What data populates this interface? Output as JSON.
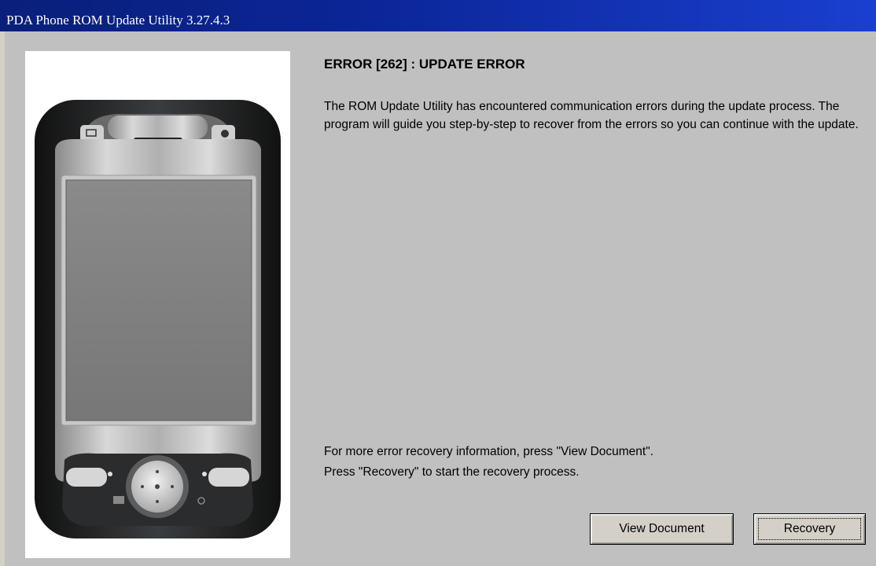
{
  "window": {
    "title": "PDA Phone ROM Update Utility 3.27.4.3",
    "titlebar_gradient": [
      "#0a1f7a",
      "#1a3fd0"
    ],
    "background": "#c0c0c0"
  },
  "error": {
    "heading": "ERROR [262] : UPDATE ERROR",
    "description": "The ROM Update Utility has encountered communication errors during the update process. The program will guide you step-by-step to recover from the errors so you can continue with the update."
  },
  "info": {
    "line1": "For more error recovery information, press \"View Document\".",
    "line2": "Press \"Recovery\" to start the recovery process."
  },
  "buttons": {
    "view_document": "View Document",
    "recovery": "Recovery"
  },
  "image": {
    "subject": "pda-phone-device"
  }
}
